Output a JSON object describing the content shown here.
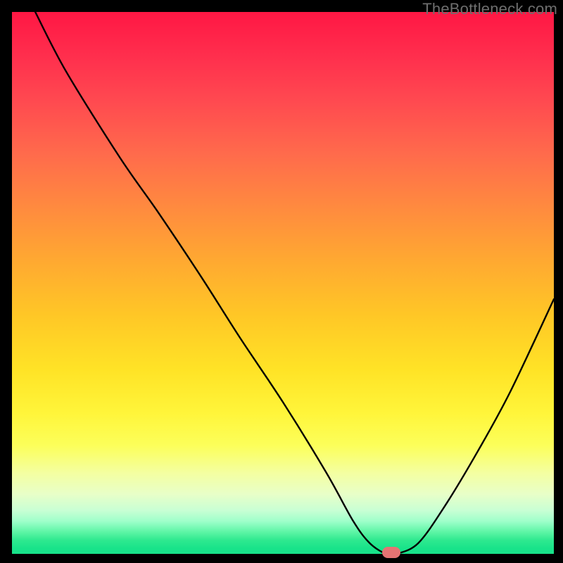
{
  "watermark": "TheBottleneck.com",
  "chart_data": {
    "type": "line",
    "title": "",
    "xlabel": "",
    "ylabel": "",
    "xlim": [
      0,
      100
    ],
    "ylim": [
      0,
      100
    ],
    "grid": false,
    "series": [
      {
        "name": "curve",
        "x": [
          4.3,
          10,
          20,
          27,
          35,
          42,
          50,
          58,
          63,
          66,
          69,
          71,
          75,
          80,
          86,
          92,
          100
        ],
        "values": [
          100,
          89,
          73,
          63,
          51,
          40,
          28,
          15,
          6,
          2,
          0,
          0,
          2,
          9,
          19,
          30,
          47
        ]
      }
    ],
    "marker": {
      "x": 70,
      "y": 0,
      "color": "#e57373"
    },
    "background_gradient": {
      "direction": "vertical",
      "stops": [
        {
          "pos": 0,
          "color": "#ff1744"
        },
        {
          "pos": 50,
          "color": "#ffb02e"
        },
        {
          "pos": 80,
          "color": "#fcff5a"
        },
        {
          "pos": 100,
          "color": "#18e38a"
        }
      ]
    }
  }
}
